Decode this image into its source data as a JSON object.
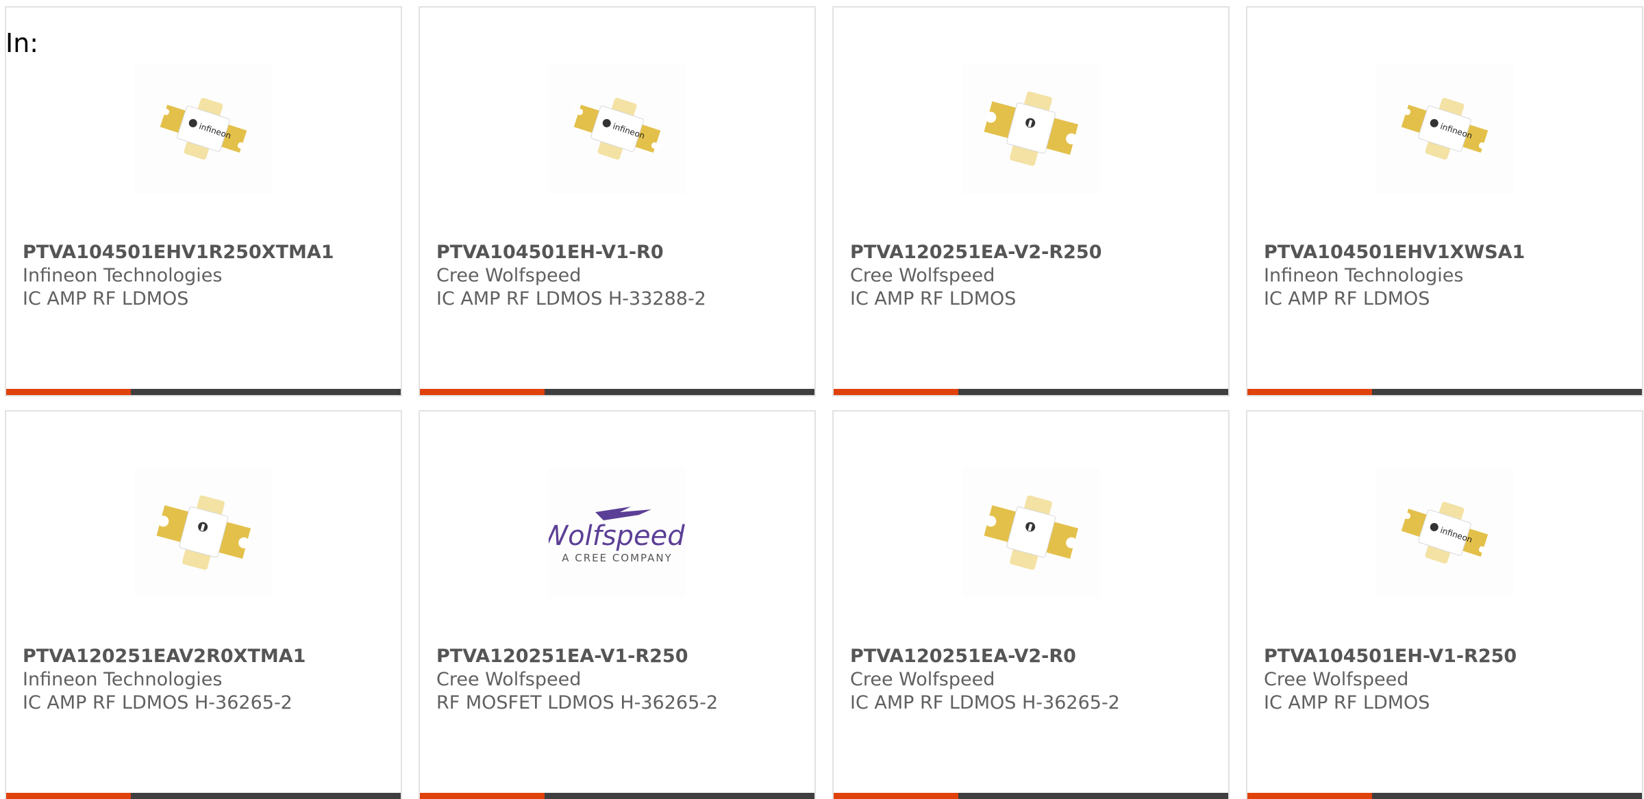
{
  "filter_label": "In:",
  "colors": {
    "accent": "#e0420c",
    "bar": "#3f3f3f",
    "border": "#e2e2e2",
    "chip_gold": "#e3c04a",
    "chip_tab": "#f3e2a4",
    "wolfspeed_purple": "#5b3f96"
  },
  "products": [
    {
      "part": "PTVA104501EHV1R250XTMA1",
      "maker": "Infineon Technologies",
      "desc": "IC AMP RF LDMOS",
      "image": "infineon-package-flat-icon"
    },
    {
      "part": "PTVA104501EH-V1-R0",
      "maker": "Cree Wolfspeed",
      "desc": "IC AMP RF LDMOS H-33288-2",
      "image": "infineon-package-flat-icon"
    },
    {
      "part": "PTVA120251EA-V2-R250",
      "maker": "Cree Wolfspeed",
      "desc": "IC AMP RF LDMOS",
      "image": "infineon-package-earless-icon"
    },
    {
      "part": "PTVA104501EHV1XWSA1",
      "maker": "Infineon Technologies",
      "desc": "IC AMP RF LDMOS",
      "image": "infineon-package-flat-icon"
    },
    {
      "part": "PTVA120251EAV2R0XTMA1",
      "maker": "Infineon Technologies",
      "desc": "IC AMP RF LDMOS H-36265-2",
      "image": "infineon-package-earless-icon"
    },
    {
      "part": "PTVA120251EA-V1-R250",
      "maker": "Cree Wolfspeed",
      "desc": "RF MOSFET LDMOS H-36265-2",
      "image": "wolfspeed-logo",
      "logo_text": "Wolfspeed.",
      "logo_tagline": "A CREE COMPANY"
    },
    {
      "part": "PTVA120251EA-V2-R0",
      "maker": "Cree Wolfspeed",
      "desc": "IC AMP RF LDMOS H-36265-2",
      "image": "infineon-package-earless-icon"
    },
    {
      "part": "PTVA104501EH-V1-R250",
      "maker": "Cree Wolfspeed",
      "desc": "IC AMP RF LDMOS",
      "image": "infineon-package-flat-icon"
    }
  ]
}
